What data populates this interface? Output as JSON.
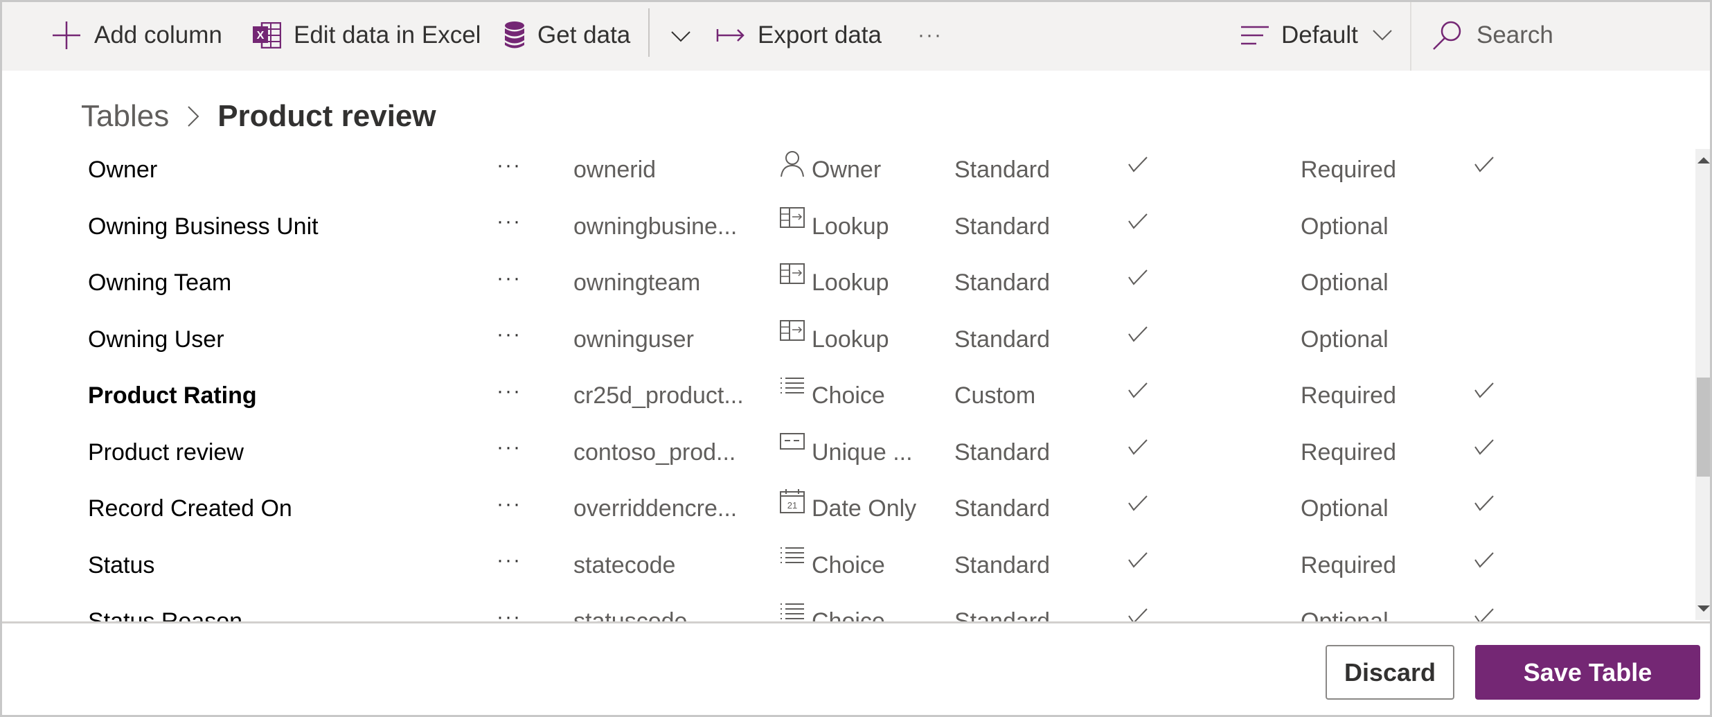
{
  "toolbar": {
    "add_column": "Add column",
    "edit_excel": "Edit data in Excel",
    "get_data": "Get data",
    "export_data": "Export data",
    "more": "···",
    "view_selector": "Default",
    "search_placeholder": "Search"
  },
  "breadcrumb": {
    "parent": "Tables",
    "current": "Product review"
  },
  "columns": [
    {
      "name": "Owner",
      "bold": false,
      "more": "···",
      "logical": "ownerid",
      "type_icon": "person-icon",
      "type": "Owner",
      "class": "Standard",
      "searchable": true,
      "requirement": "Required",
      "check2": true
    },
    {
      "name": "Owning Business Unit",
      "bold": false,
      "more": "···",
      "logical": "owningbusine...",
      "type_icon": "lookup-icon",
      "type": "Lookup",
      "class": "Standard",
      "searchable": true,
      "requirement": "Optional",
      "check2": false
    },
    {
      "name": "Owning Team",
      "bold": false,
      "more": "···",
      "logical": "owningteam",
      "type_icon": "lookup-icon",
      "type": "Lookup",
      "class": "Standard",
      "searchable": true,
      "requirement": "Optional",
      "check2": false
    },
    {
      "name": "Owning User",
      "bold": false,
      "more": "···",
      "logical": "owninguser",
      "type_icon": "lookup-icon",
      "type": "Lookup",
      "class": "Standard",
      "searchable": true,
      "requirement": "Optional",
      "check2": false
    },
    {
      "name": "Product Rating",
      "bold": true,
      "more": "···",
      "logical": "cr25d_product...",
      "type_icon": "choice-icon",
      "type": "Choice",
      "class": "Custom",
      "searchable": true,
      "requirement": "Required",
      "check2": true
    },
    {
      "name": "Product review",
      "bold": false,
      "more": "···",
      "logical": "contoso_prod...",
      "type_icon": "unique-id-icon",
      "type": "Unique ...",
      "class": "Standard",
      "searchable": true,
      "requirement": "Required",
      "check2": true
    },
    {
      "name": "Record Created On",
      "bold": false,
      "more": "···",
      "logical": "overriddencre...",
      "type_icon": "calendar-icon",
      "type": "Date Only",
      "class": "Standard",
      "searchable": true,
      "requirement": "Optional",
      "check2": true
    },
    {
      "name": "Status",
      "bold": false,
      "more": "···",
      "logical": "statecode",
      "type_icon": "choice-icon",
      "type": "Choice",
      "class": "Standard",
      "searchable": true,
      "requirement": "Required",
      "check2": true
    },
    {
      "name": "Status Reason",
      "bold": false,
      "more": "···",
      "logical": "statuscode",
      "type_icon": "choice-icon",
      "type": "Choice",
      "class": "Standard",
      "searchable": true,
      "requirement": "Optional",
      "check2": true
    }
  ],
  "scroll": {
    "position_fraction": 0.55
  },
  "footer": {
    "discard": "Discard",
    "save": "Save Table"
  },
  "colors": {
    "accent": "#742774",
    "toolbar_bg": "#f3f2f1"
  }
}
